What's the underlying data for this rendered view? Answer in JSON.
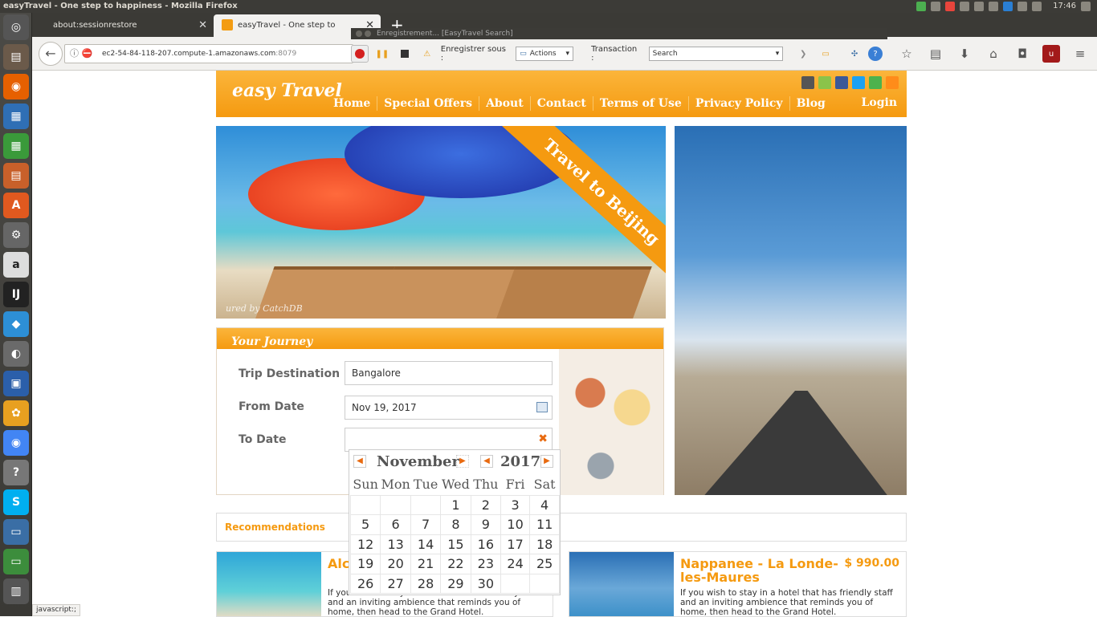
{
  "os": {
    "window_title": "easyTravel - One step to happiness - Mozilla Firefox",
    "clock": "17:46"
  },
  "tabs": [
    {
      "label": "about:sessionrestore"
    },
    {
      "label": "easyTravel - One step to happiness"
    }
  ],
  "urlbar": {
    "host": "ec2-54-84-118-207.compute-1.amazonaws.com",
    "port": ":8079"
  },
  "recorder": {
    "title": "Enregistrement... [EasyTravel Search]",
    "save_as_label": "Enregistrer sous :",
    "save_as_value": "Actions",
    "transaction_label": "Transaction :",
    "transaction_value": "Search"
  },
  "site": {
    "logo": "easy Travel",
    "nav": [
      "Home",
      "Special Offers",
      "About",
      "Contact",
      "Terms of Use",
      "Privacy Policy",
      "Blog"
    ],
    "login": "Login",
    "hero_banner": "Travel to Beijing",
    "hero_credit": "ured by CatchDB"
  },
  "journey": {
    "title": "Your Journey",
    "destination_label": "Trip Destination",
    "destination_value": "Bangalore",
    "from_label": "From Date",
    "from_value": "Nov 19, 2017",
    "to_label": "To Date",
    "to_value": ""
  },
  "calendar": {
    "month": "November",
    "year": "2017",
    "weekdays": [
      "Sun",
      "Mon",
      "Tue",
      "Wed",
      "Thu",
      "Fri",
      "Sat"
    ],
    "weeks": [
      [
        "",
        "",
        "",
        "1",
        "2",
        "3",
        "4"
      ],
      [
        "5",
        "6",
        "7",
        "8",
        "9",
        "10",
        "11"
      ],
      [
        "12",
        "13",
        "14",
        "15",
        "16",
        "17",
        "18"
      ],
      [
        "19",
        "20",
        "21",
        "22",
        "23",
        "24",
        "25"
      ],
      [
        "26",
        "27",
        "28",
        "29",
        "30",
        "",
        ""
      ]
    ]
  },
  "recommendations": {
    "title": "Recommendations",
    "cards": [
      {
        "name": "Alc",
        "price": "",
        "desc": "If you wish to stay in a hotel that has friendly staff and an inviting ambience that reminds you of home, then head to the Grand Hotel."
      },
      {
        "name": "Nappanee - La Londe-les-Maures",
        "price": "$ 990.00",
        "desc": "If you wish to stay in a hotel that has friendly staff and an inviting ambience that reminds you of home, then head to the Grand Hotel."
      }
    ]
  },
  "statusbar": "javascript:;"
}
